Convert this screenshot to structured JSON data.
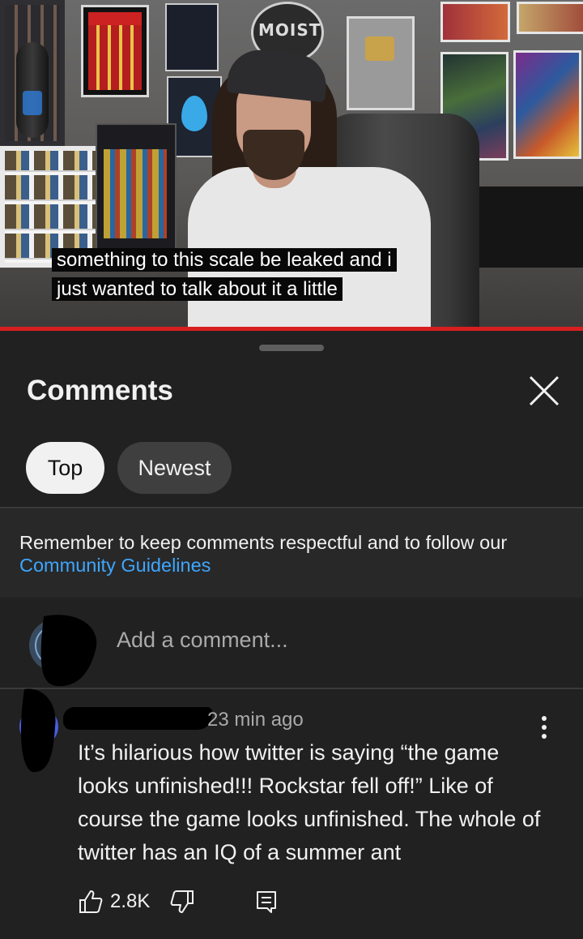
{
  "video": {
    "caption_line1": "something to this scale be leaked and i",
    "caption_line2": "just wanted to talk about it a little",
    "progress_fraction": 1.0,
    "progress_color": "#d81f1f"
  },
  "comments_sheet": {
    "title": "Comments",
    "close_icon": "close-icon",
    "chips": [
      {
        "label": "Top",
        "selected": true
      },
      {
        "label": "Newest",
        "selected": false
      }
    ],
    "notice": {
      "text": "Remember to keep comments respectful and to follow our",
      "link_text": "Community Guidelines",
      "link_color": "#3ea6ff"
    },
    "add_comment": {
      "placeholder": "Add a comment..."
    },
    "comments": [
      {
        "time": "23 min ago",
        "text": "It’s hilarious how twitter is saying “the game looks unfinished!!! Rockstar fell off!” Like of course the game looks unfinished. The whole of twitter has an IQ of a summer ant",
        "likes": "2.8K",
        "icons": [
          "like-icon",
          "dislike-icon",
          "reply-icon",
          "more-vert-icon"
        ]
      }
    ]
  }
}
